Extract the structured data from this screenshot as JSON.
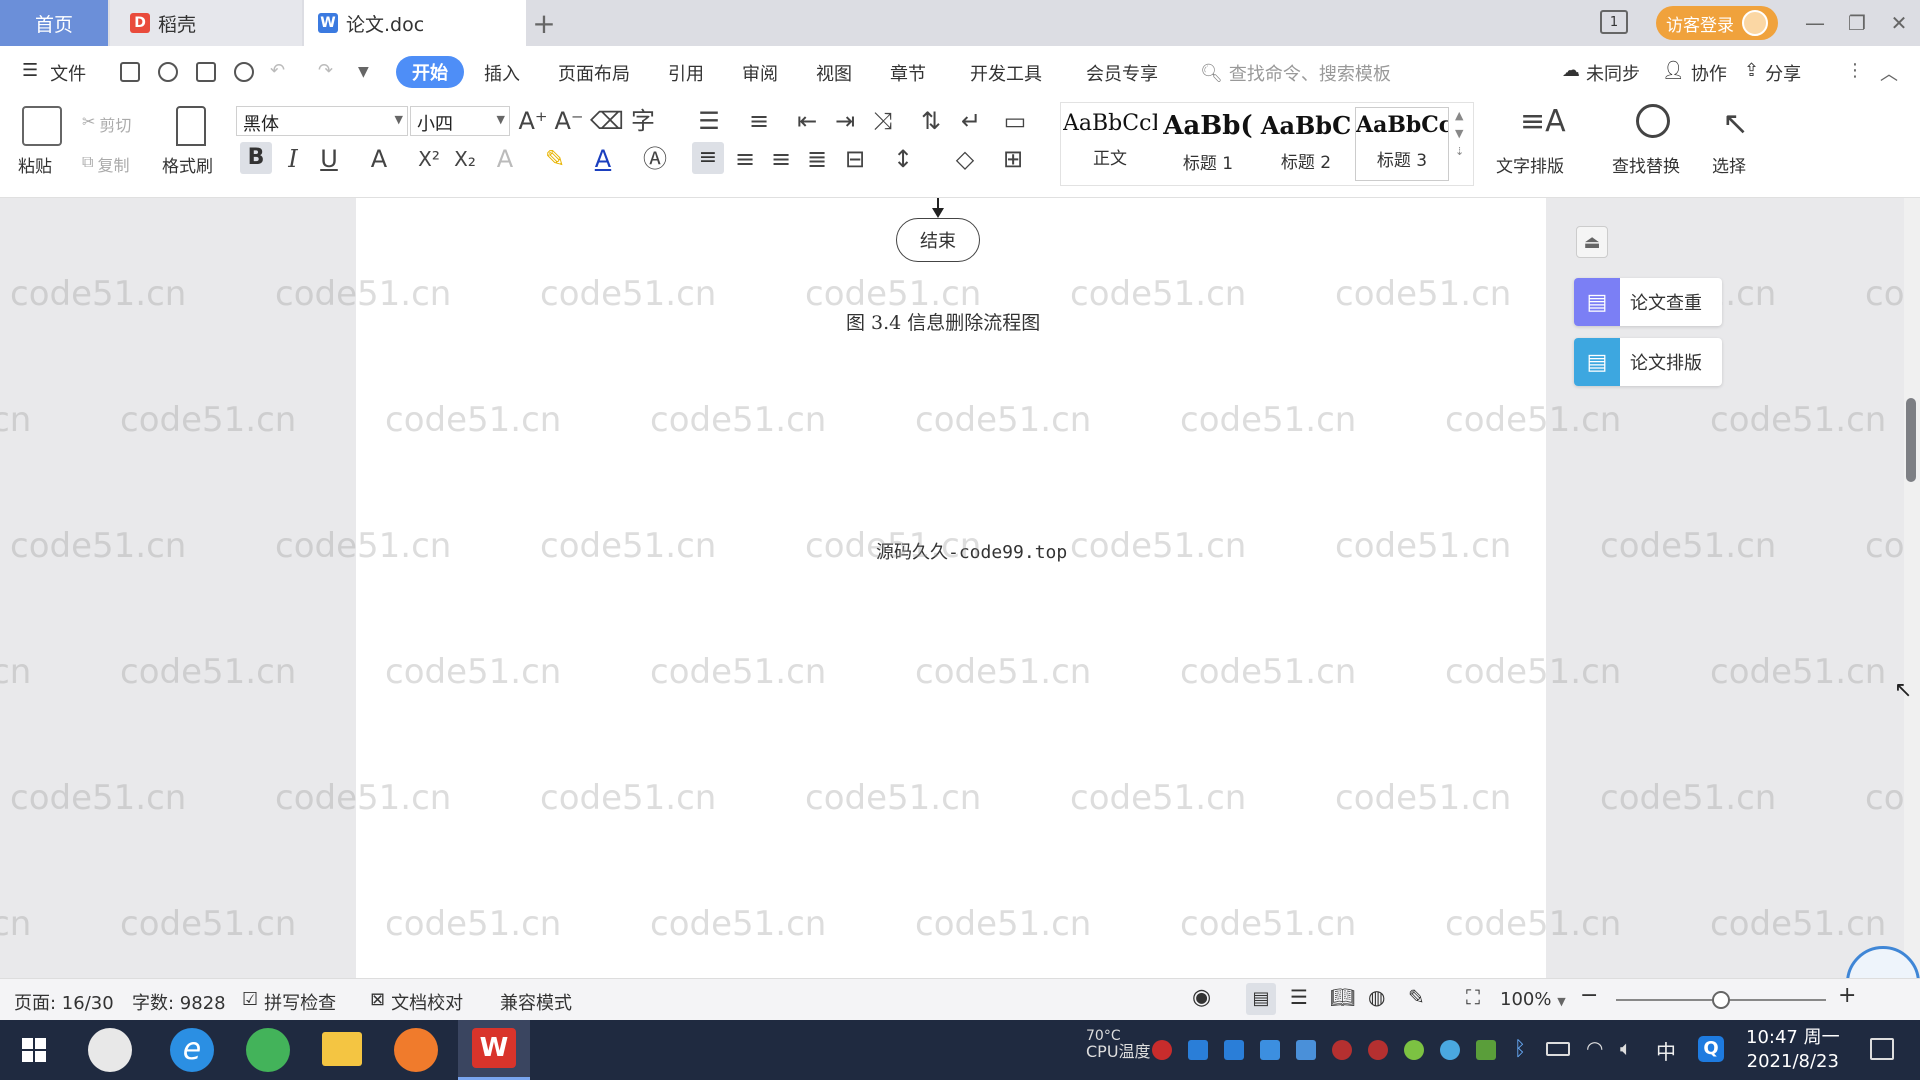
{
  "titlebar": {
    "tabs": [
      {
        "label": "首页"
      },
      {
        "label": "稻壳"
      },
      {
        "label": "论文.doc"
      }
    ],
    "page_indicator": "1",
    "guest_login": "访客登录"
  },
  "menubar": {
    "file": "文件",
    "items": [
      "开始",
      "插入",
      "页面布局",
      "引用",
      "审阅",
      "视图",
      "章节",
      "开发工具",
      "会员专享"
    ],
    "search_placeholder": "查找命令、搜索模板",
    "sync": "未同步",
    "collab": "协作",
    "share": "分享"
  },
  "ribbon": {
    "paste": "粘贴",
    "cut": "剪切",
    "copy": "复制",
    "format_painter": "格式刷",
    "font_name": "黑体",
    "font_size": "小四",
    "styles": [
      {
        "sample": "AaBbCcI",
        "name": "正文"
      },
      {
        "sample": "AaBb(",
        "name": "标题 1"
      },
      {
        "sample": "AaBbC",
        "name": "标题 2"
      },
      {
        "sample": "AaBbCcl",
        "name": "标题 3"
      }
    ],
    "text_layout": "文字排版",
    "find_replace": "查找替换",
    "select": "选择"
  },
  "document": {
    "end_node": "结束",
    "caption": "图 3.4  信息删除流程图",
    "source_text": "源码久久-code99.top",
    "watermark": "code51.cn"
  },
  "side_panel": {
    "check": "论文查重",
    "layout": "论文排版"
  },
  "statusbar": {
    "page": "页面: 16/30",
    "word_count": "字数: 9828",
    "spell_check": "拼写检查",
    "proofread": "文档校对",
    "compat_mode": "兼容模式",
    "zoom": "100%",
    "zoom_level": 0.5
  },
  "taskbar": {
    "cpu_temp": "70°C",
    "cpu_label": "CPU温度",
    "ime": "中",
    "time": "10:47 周一",
    "date": "2021/8/23"
  }
}
